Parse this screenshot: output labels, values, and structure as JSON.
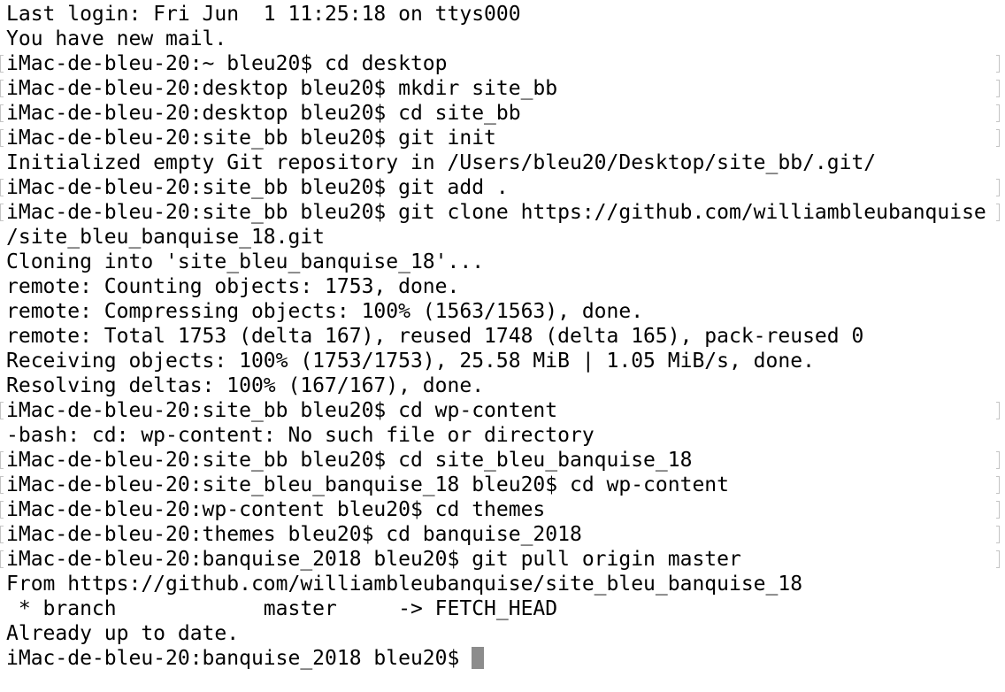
{
  "terminal": {
    "lines": [
      {
        "text": "Last login: Fri Jun  1 11:25:18 on ttys000",
        "marked": false
      },
      {
        "text": "You have new mail.",
        "marked": false
      },
      {
        "text": "iMac-de-bleu-20:~ bleu20$ cd desktop",
        "marked": true
      },
      {
        "text": "iMac-de-bleu-20:desktop bleu20$ mkdir site_bb",
        "marked": true
      },
      {
        "text": "iMac-de-bleu-20:desktop bleu20$ cd site_bb",
        "marked": true
      },
      {
        "text": "iMac-de-bleu-20:site_bb bleu20$ git init",
        "marked": true
      },
      {
        "text": "Initialized empty Git repository in /Users/bleu20/Desktop/site_bb/.git/",
        "marked": false
      },
      {
        "text": "iMac-de-bleu-20:site_bb bleu20$ git add .",
        "marked": true
      },
      {
        "text": "iMac-de-bleu-20:site_bb bleu20$ git clone https://github.com/williambleubanquise",
        "marked": true
      },
      {
        "text": "/site_bleu_banquise_18.git",
        "marked": false
      },
      {
        "text": "Cloning into 'site_bleu_banquise_18'...",
        "marked": false
      },
      {
        "text": "remote: Counting objects: 1753, done.",
        "marked": false
      },
      {
        "text": "remote: Compressing objects: 100% (1563/1563), done.",
        "marked": false
      },
      {
        "text": "remote: Total 1753 (delta 167), reused 1748 (delta 165), pack-reused 0",
        "marked": false
      },
      {
        "text": "Receiving objects: 100% (1753/1753), 25.58 MiB | 1.05 MiB/s, done.",
        "marked": false
      },
      {
        "text": "Resolving deltas: 100% (167/167), done.",
        "marked": false
      },
      {
        "text": "iMac-de-bleu-20:site_bb bleu20$ cd wp-content",
        "marked": true
      },
      {
        "text": "-bash: cd: wp-content: No such file or directory",
        "marked": false
      },
      {
        "text": "iMac-de-bleu-20:site_bb bleu20$ cd site_bleu_banquise_18",
        "marked": true
      },
      {
        "text": "iMac-de-bleu-20:site_bleu_banquise_18 bleu20$ cd wp-content",
        "marked": true
      },
      {
        "text": "iMac-de-bleu-20:wp-content bleu20$ cd themes",
        "marked": true
      },
      {
        "text": "iMac-de-bleu-20:themes bleu20$ cd banquise_2018",
        "marked": true
      },
      {
        "text": "iMac-de-bleu-20:banquise_2018 bleu20$ git pull origin master",
        "marked": true
      },
      {
        "text": "From https://github.com/williambleubanquise/site_bleu_banquise_18",
        "marked": false
      },
      {
        "text": " * branch            master     -> FETCH_HEAD",
        "marked": false
      },
      {
        "text": "Already up to date.",
        "marked": false
      }
    ],
    "prompt": "iMac-de-bleu-20:banquise_2018 bleu20$ ",
    "colors": {
      "background": "#ffffff",
      "text": "#000000",
      "cursor": "#8c8c8c",
      "mark": "#c4c4c4"
    }
  }
}
